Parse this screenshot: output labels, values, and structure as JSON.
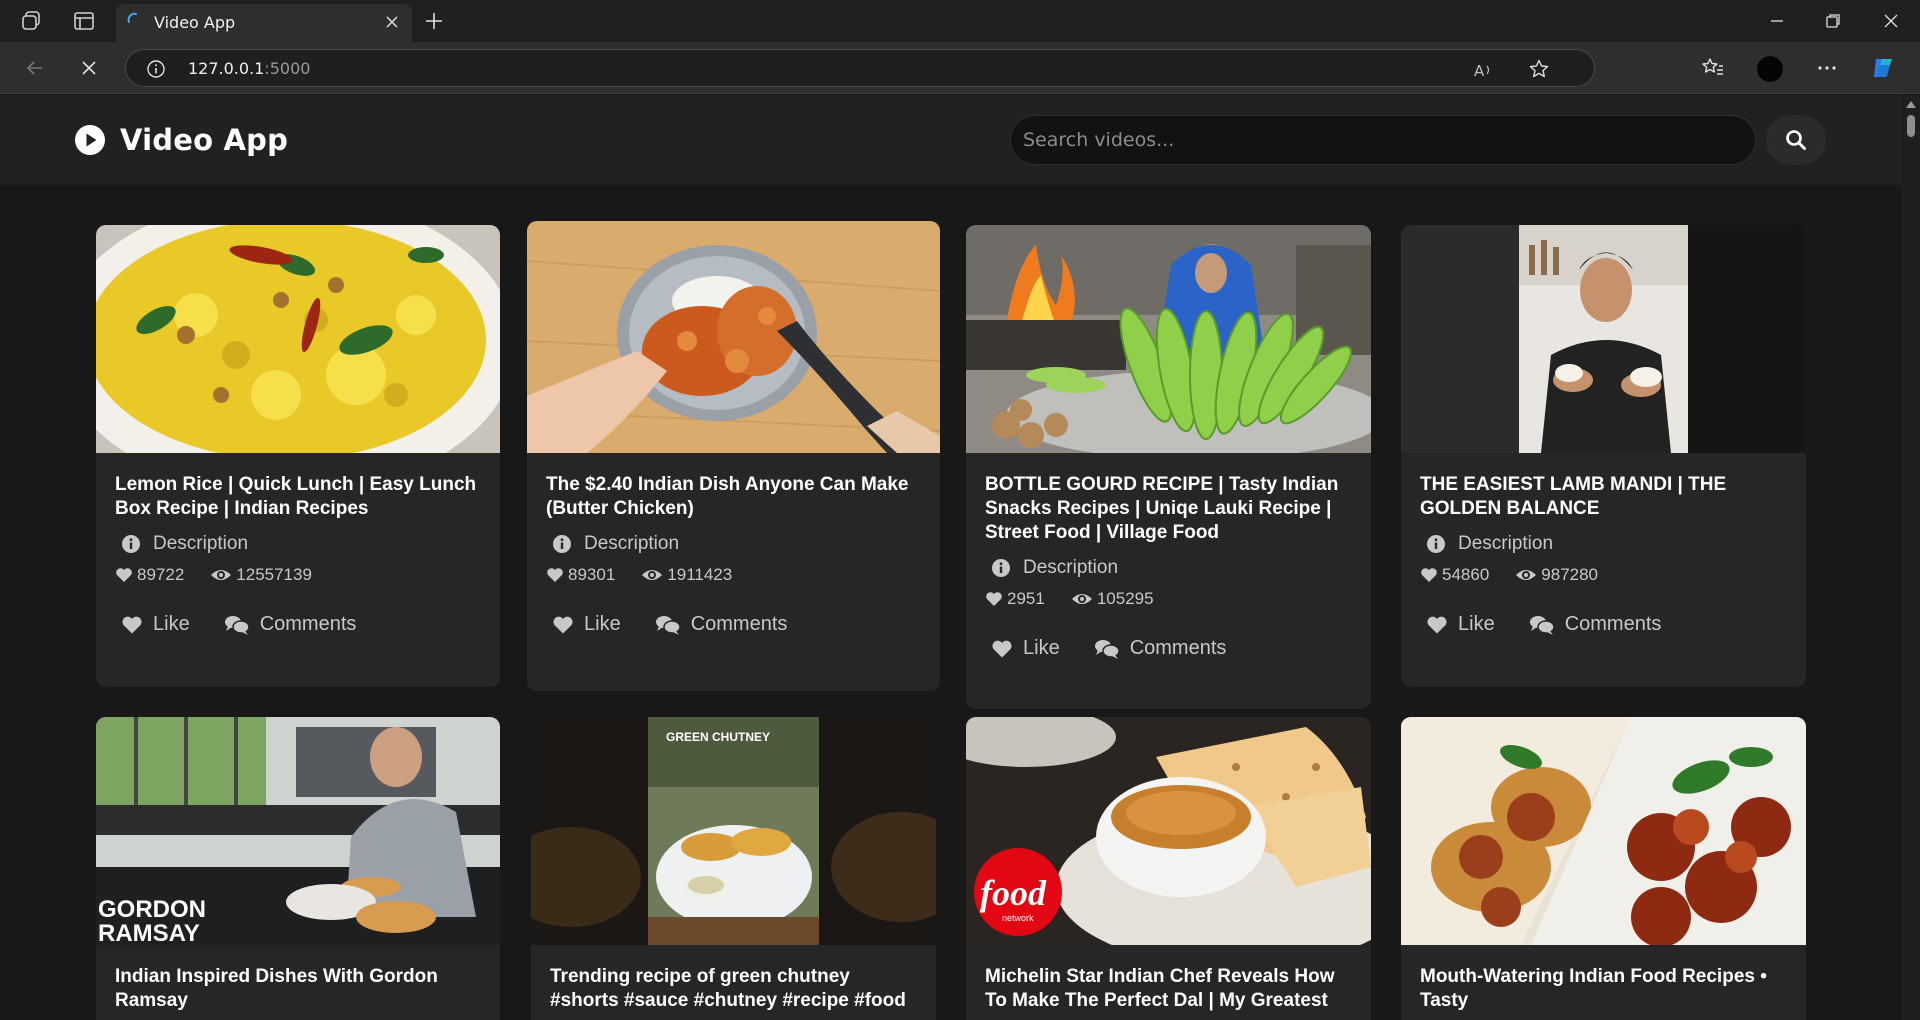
{
  "browser": {
    "tab_title": "Video App",
    "url_host": "127.0.0.1",
    "url_port": ":5000"
  },
  "app": {
    "name": "Video App",
    "search_placeholder": "Search videos..."
  },
  "videos": [
    {
      "title": "Lemon Rice | Quick Lunch | Easy Lunch Box Recipe | Indian Recipes",
      "description_label": "Description",
      "likes": "89722",
      "views": "12557139",
      "like_label": "Like",
      "comments_label": "Comments",
      "thumb_text": ""
    },
    {
      "title": "The $2.40 Indian Dish Anyone Can Make (Butter Chicken)",
      "description_label": "Description",
      "likes": "89301",
      "views": "1911423",
      "like_label": "Like",
      "comments_label": "Comments",
      "thumb_text": ""
    },
    {
      "title": "BOTTLE GOURD RECIPE | Tasty Indian Snacks Recipes | Uniqe Lauki Recipe | Street Food | Village Food",
      "description_label": "Description",
      "likes": "2951",
      "views": "105295",
      "like_label": "Like",
      "comments_label": "Comments",
      "thumb_text": ""
    },
    {
      "title": "THE EASIEST LAMB MANDI | THE GOLDEN BALANCE",
      "description_label": "Description",
      "likes": "54860",
      "views": "987280",
      "like_label": "Like",
      "comments_label": "Comments",
      "thumb_text": ""
    },
    {
      "title": "Indian Inspired Dishes With Gordon Ramsay",
      "thumb_text": "GORDON RAMSAY"
    },
    {
      "title": "Trending recipe of green chutney #shorts #sauce #chutney #recipe #food",
      "thumb_text": "GREEN CHUTNEY"
    },
    {
      "title": "Michelin Star Indian Chef Reveals How To Make The Perfect Dal | My Greatest",
      "thumb_text": "food"
    },
    {
      "title": "Mouth-Watering Indian Food Recipes • Tasty",
      "thumb_text": ""
    }
  ],
  "colors": {
    "page_bg": "#181818",
    "header_bg": "#212121",
    "card_bg": "#262626",
    "text_primary": "#ffffff",
    "text_secondary": "#c8c8c8"
  },
  "icons": [
    "play-circle-icon",
    "search-icon",
    "info-icon",
    "heart-icon",
    "eye-icon",
    "comments-icon"
  ]
}
